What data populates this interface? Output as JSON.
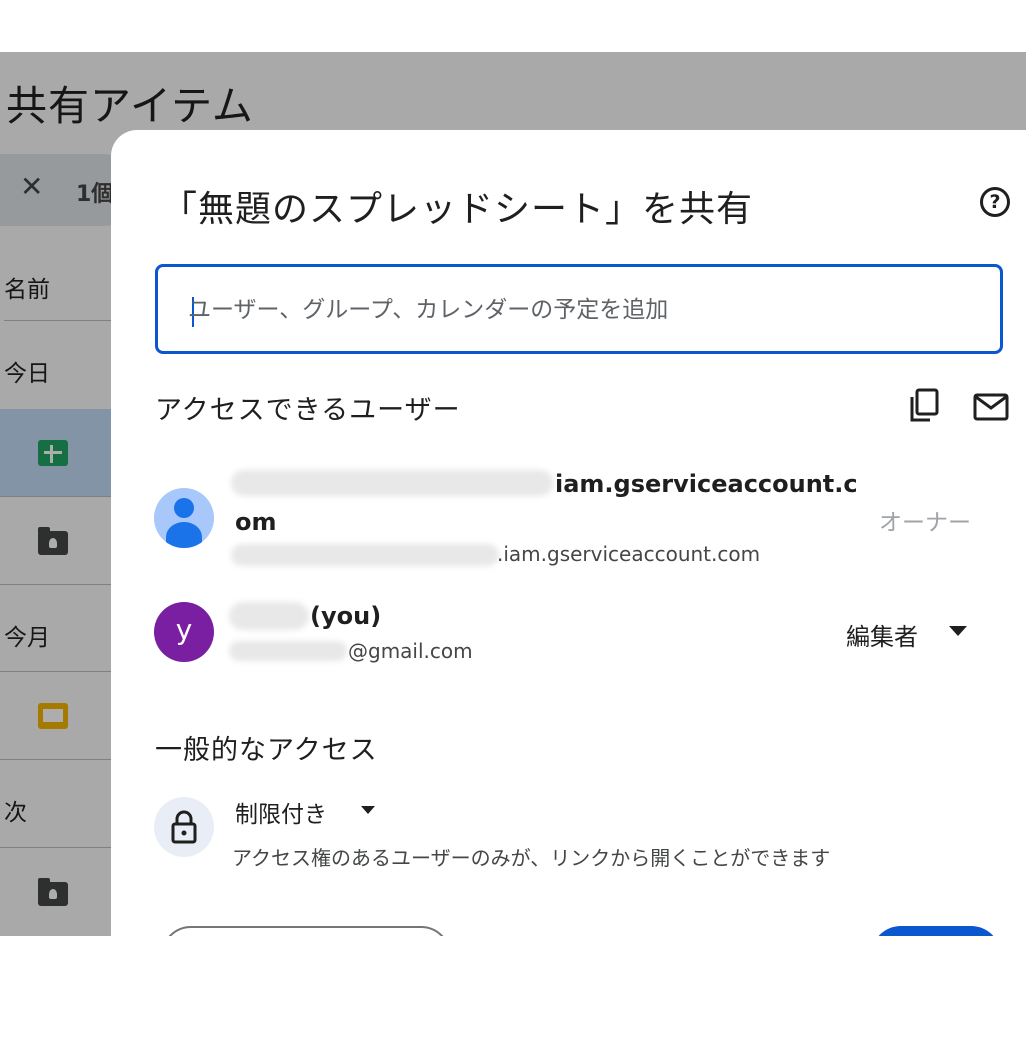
{
  "background": {
    "page_title": "共有アイテム",
    "selection_chip": {
      "close_glyph": "✕",
      "count": "1個"
    },
    "column_header": "名前",
    "groups": [
      "今日",
      "今月",
      "次"
    ]
  },
  "dialog": {
    "title": "「無題のスプレッドシート」を共有",
    "help_glyph": "?",
    "add_people": {
      "placeholder": "ユーザー、グループ、カレンダーの予定を追加"
    },
    "people_section_title": "アクセスできるユーザー",
    "people": [
      {
        "avatar": "person-icon",
        "name_line1": "iam.gserviceaccount.c",
        "name_line2": "om",
        "email": ".iam.gserviceaccount.com",
        "role": "オーナー"
      },
      {
        "avatar_letter": "y",
        "avatar_color": "#7b1fa2",
        "name": "(you)",
        "email": "@gmail.com",
        "role": "編集者"
      }
    ],
    "general_access": {
      "title": "一般的なアクセス",
      "level": "制限付き",
      "description": "アクセス権のあるユーザーのみが、リンクから開くことができます"
    }
  },
  "colors": {
    "accent": "#0b57d0",
    "you_avatar": "#7b1fa2",
    "service_avatar": "#a8c7fa"
  }
}
